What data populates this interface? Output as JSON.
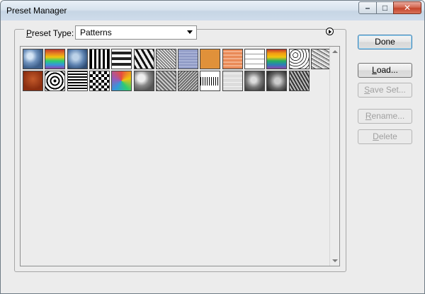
{
  "window": {
    "title": "Preset Manager",
    "controls": {
      "minimize": "–",
      "maximize": "□",
      "close": "✕"
    }
  },
  "preset_type": {
    "label_underlined": "P",
    "label_rest": "reset Type:",
    "selected": "Patterns"
  },
  "list": {
    "patterns": [
      {
        "icon": "blue-bubbles-pattern-icon"
      },
      {
        "icon": "rainbow-pattern-icon"
      },
      {
        "icon": "blue-bubbles-pattern-icon"
      },
      {
        "icon": "black-white-stripes-pattern-icon"
      },
      {
        "icon": "grayscale-blocks-pattern-icon"
      },
      {
        "icon": "zebra-stripes-pattern-icon"
      },
      {
        "icon": "gray-noise-pattern-icon"
      },
      {
        "icon": "denim-blue-pattern-icon"
      },
      {
        "icon": "orange-fill-pattern-icon"
      },
      {
        "icon": "salmon-weave-pattern-icon"
      },
      {
        "icon": "white-grid-pattern-icon"
      },
      {
        "icon": "rainbow-pattern-icon"
      },
      {
        "icon": "black-white-spots-pattern-icon"
      },
      {
        "icon": "gray-marble-pattern-icon"
      },
      {
        "icon": "rust-texture-pattern-icon"
      },
      {
        "icon": "concentric-squares-pattern-icon"
      },
      {
        "icon": "black-white-lines-pattern-icon"
      },
      {
        "icon": "checkerboard-pattern-icon"
      },
      {
        "icon": "colorful-swirl-pattern-icon"
      },
      {
        "icon": "gray-clouds-pattern-icon"
      },
      {
        "icon": "gray-noise-pattern-icon"
      },
      {
        "icon": "gray-noise-pattern-icon"
      },
      {
        "icon": "black-dots-strip-pattern-icon"
      },
      {
        "icon": "white-brick-pattern-icon"
      },
      {
        "icon": "gray-clouds-pattern-icon"
      },
      {
        "icon": "gray-clouds-pattern-icon"
      },
      {
        "icon": "gray-noise-pattern-icon"
      }
    ]
  },
  "buttons": {
    "done": "Done",
    "load_u": "L",
    "load_rest": "oad...",
    "save_u": "S",
    "save_rest": "ave Set...",
    "rename_u": "R",
    "rename_rest": "ename...",
    "delete_u": "D",
    "delete_rest": "elete"
  },
  "colors": {
    "dialog_bg": "#ececec",
    "default_button_border": "#3c7fb1",
    "close_button": "#c4452c",
    "disabled_text": "#a0a0a0"
  }
}
